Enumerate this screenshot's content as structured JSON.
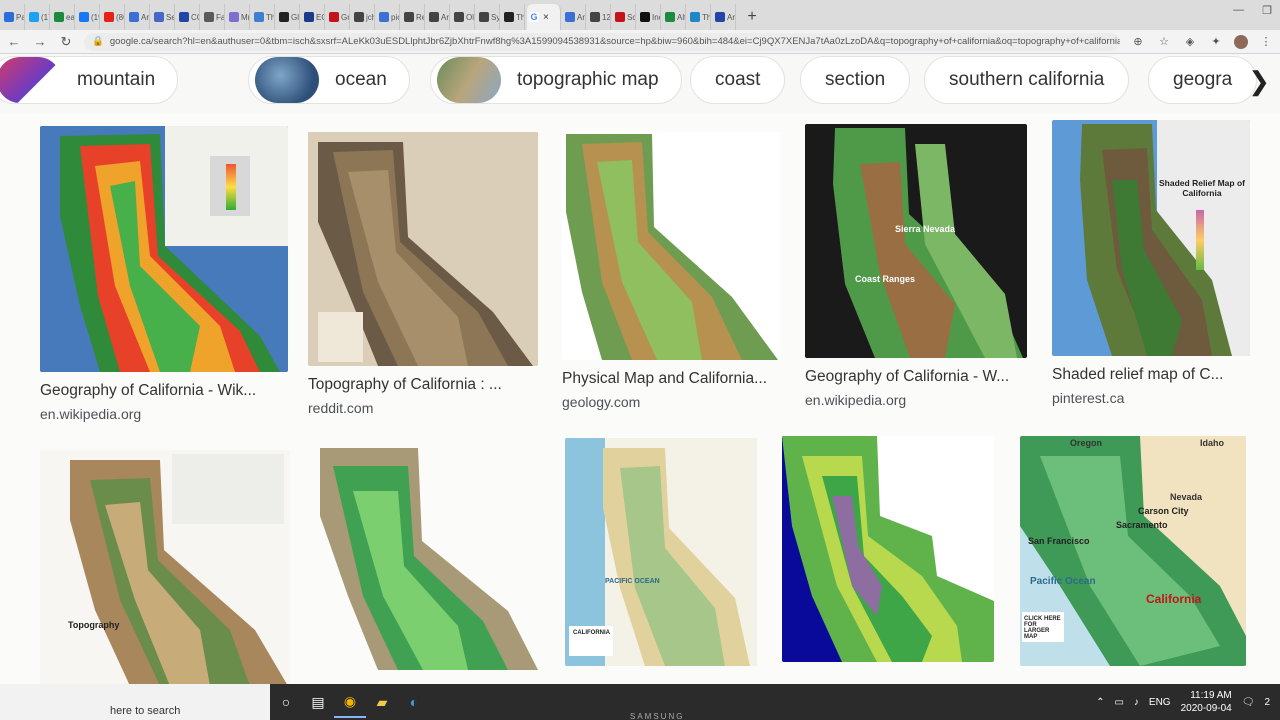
{
  "tabs": [
    {
      "label": "Pa",
      "color": "#2c6fdb"
    },
    {
      "label": "(17",
      "color": "#1da1f2"
    },
    {
      "label": "ea",
      "color": "#1d8a3d"
    },
    {
      "label": "(19",
      "color": "#1877f2"
    },
    {
      "label": "(86",
      "color": "#e62117"
    },
    {
      "label": "Ar",
      "color": "#3b6fd6"
    },
    {
      "label": "Se",
      "color": "#4567c9"
    },
    {
      "label": "CO",
      "color": "#2445a8"
    },
    {
      "label": "Fa",
      "color": "#5a5a5a"
    },
    {
      "label": "M(",
      "color": "#7b6fd0"
    },
    {
      "label": "Th",
      "color": "#3e7fd0"
    },
    {
      "label": "Gl",
      "color": "#222222"
    },
    {
      "label": "EC",
      "color": "#1c3a8a"
    },
    {
      "label": "Gr",
      "color": "#c4131a"
    },
    {
      "label": "jch",
      "color": "#444444"
    },
    {
      "label": "pic",
      "color": "#3b6fd6"
    },
    {
      "label": "Re",
      "color": "#444444"
    },
    {
      "label": "Ar",
      "color": "#444444"
    },
    {
      "label": "Ol",
      "color": "#444444"
    },
    {
      "label": "Sy",
      "color": "#444444"
    },
    {
      "label": "Th",
      "color": "#222222"
    }
  ],
  "active_tab": {
    "label": "G",
    "close": "×"
  },
  "tabs_after": [
    {
      "label": "An",
      "color": "#3b6fd6"
    },
    {
      "label": "12",
      "color": "#444444"
    },
    {
      "label": "Sci",
      "color": "#c4131a"
    },
    {
      "label": "Inc",
      "color": "#111111"
    },
    {
      "label": "Alt",
      "color": "#1d8a3d"
    },
    {
      "label": "Th",
      "color": "#1e88c7"
    },
    {
      "label": "An",
      "color": "#2445a8"
    }
  ],
  "new_tab": "+",
  "address": {
    "url": "google.ca/search?hl=en&authuser=0&tbm=isch&sxsrf=ALeKk03uESDLlphtJbr6ZjbXhtrFnwf8hg%3A1599094538931&source=hp&biw=960&bih=484&ei=Cj9QX7XENJa7tAa0zLzoDA&q=topography+of+california&oq=topography+of+california&gs_lcp..."
  },
  "chips": [
    {
      "label": "mountain",
      "has_thumb": true
    },
    {
      "label": "ocean",
      "has_thumb": true
    },
    {
      "label": "topographic map",
      "has_thumb": true
    },
    {
      "label": "coast",
      "has_thumb": false
    },
    {
      "label": "section",
      "has_thumb": false
    },
    {
      "label": "southern california",
      "has_thumb": false
    },
    {
      "label": "geogra",
      "has_thumb": false
    }
  ],
  "results": [
    {
      "caption": "Geography of California - Wik...",
      "source": "en.wikipedia.org"
    },
    {
      "caption": "Topography of California : ...",
      "source": "reddit.com"
    },
    {
      "caption": "Physical Map and California...",
      "source": "geology.com"
    },
    {
      "caption": "Geography of California - W...",
      "source": "en.wikipedia.org"
    },
    {
      "caption": "Shaded relief map of C...",
      "source": "pinterest.ca"
    }
  ],
  "map_text": {
    "shaded_title": "Shaded Relief Map of California",
    "topography_label": "Topography",
    "pacific_ocean": "PACIFIC OCEAN",
    "california_label": "CALIFORNIA",
    "r10_oregon": "Oregon",
    "r10_idaho": "Idaho",
    "r10_nevada": "Nevada",
    "r10_carson": "Carson City",
    "r10_california": "California",
    "r10_pacific": "Pacific Ocean",
    "r10_click": "CLICK HERE FOR LARGER MAP",
    "r10_sanfrancisco": "San Francisco",
    "r10_sacramento": "Sacramento",
    "r4_sierra": "Sierra Nevada",
    "r4_coast": "Coast Ranges"
  },
  "taskbar": {
    "search_placeholder": "here to search",
    "lang": "ENG",
    "time": "11:19 AM",
    "date": "2020-09-04",
    "notif": "2"
  },
  "bezel": "SAMSUNG"
}
